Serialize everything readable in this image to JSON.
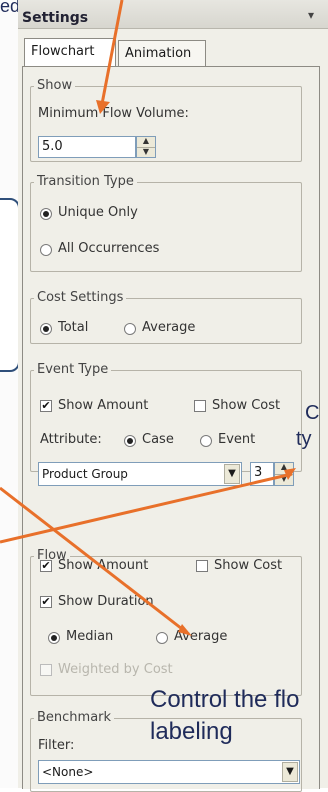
{
  "annotations": {
    "top_partial": "edian",
    "event_type_callout_line1": "C",
    "event_type_callout_line2": "ty",
    "flow_callout_line1": "Control the flo",
    "flow_callout_line2": "labeling"
  },
  "window": {
    "title": "Settings",
    "pin_icon": "pin-icon"
  },
  "tabs": [
    {
      "label": "Flowchart",
      "active": true
    },
    {
      "label": "Animation",
      "active": false
    }
  ],
  "show": {
    "legend": "Show",
    "min_flow_label": "Minimum Flow Volume:",
    "min_flow_value": "5.0"
  },
  "transition_type": {
    "legend": "Transition Type",
    "options": [
      "Unique Only",
      "All Occurrences"
    ],
    "selected": "Unique Only"
  },
  "cost_settings": {
    "legend": "Cost Settings",
    "options": [
      "Total",
      "Average"
    ],
    "selected": "Total"
  },
  "event_type": {
    "legend": "Event Type",
    "show_amount_label": "Show Amount",
    "show_amount_checked": true,
    "show_cost_label": "Show Cost",
    "show_cost_checked": false,
    "attribute_label": "Attribute:",
    "attribute_options": [
      "Case",
      "Event"
    ],
    "attribute_selected": "Case",
    "select_value": "Product Group",
    "level_value": "3"
  },
  "flow": {
    "legend": "Flow",
    "show_amount_label": "Show Amount",
    "show_amount_checked": true,
    "show_cost_label": "Show Cost",
    "show_cost_checked": false,
    "show_duration_label": "Show Duration",
    "show_duration_checked": true,
    "duration_options": [
      "Median",
      "Average"
    ],
    "duration_selected": "Median",
    "weighted_label": "Weighted by Cost",
    "weighted_checked": false
  },
  "benchmark": {
    "legend": "Benchmark",
    "filter_label": "Filter:",
    "filter_value": "<None>"
  },
  "colors": {
    "arrow": "#e8702a",
    "callout_border": "#2f4f7a",
    "panel": "#f0efe8"
  }
}
